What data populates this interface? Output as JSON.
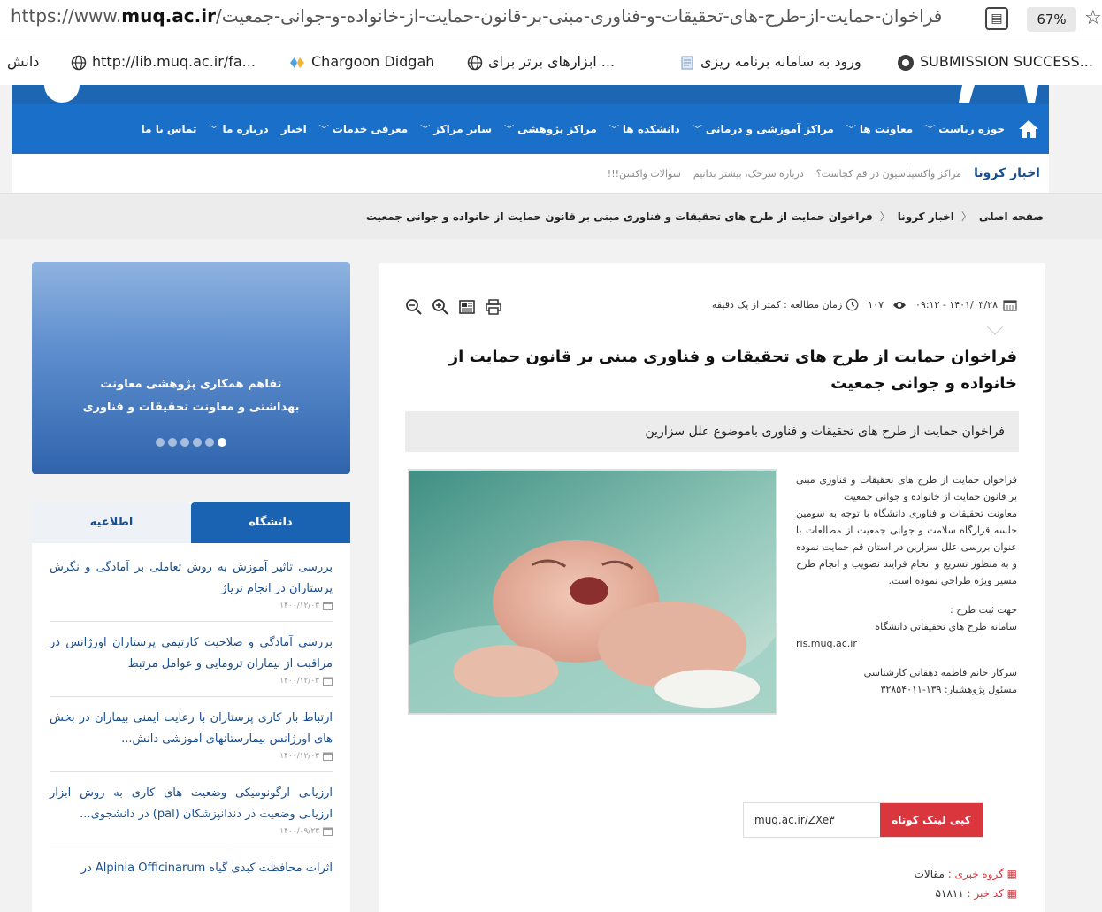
{
  "browser": {
    "url_host": "muq.ac.ir",
    "url_prefix": "https://www.",
    "url_path": "/فراخوان-حمایت-از-طرح-های-تحقیقات-و-فناوری-مبنی-بر-قانون-حمایت-از-خانواده-و-جوانی-جمعیت",
    "reader_icon": "reader-view-icon",
    "zoom": "67%",
    "bookmarks": [
      {
        "label": "http://lib.muq.ac.ir/fa...",
        "icon": "globe-icon"
      },
      {
        "label": "Chargoon Didgah",
        "icon": "chargoon-icon"
      },
      {
        "label": "ابزارهای برتر برای ...",
        "icon": "globe-icon"
      },
      {
        "label": "ورود به سامانه برنامه ریزی",
        "icon": "page-icon"
      },
      {
        "label": "SUBMISSION SUCCESS...",
        "icon": "submission-icon"
      },
      {
        "label": "دانش",
        "icon": ""
      }
    ]
  },
  "nav": {
    "items": [
      "حوزه ریاست",
      "معاونت ها",
      "مراکز آموزشی و درمانی",
      "دانشکده ها",
      "مراکز پژوهشی",
      "سایر مراکز",
      "معرفی خدمات",
      "اخبار",
      "درباره ما",
      "تماس با ما"
    ],
    "has_chevron": [
      true,
      true,
      true,
      true,
      true,
      true,
      true,
      false,
      true,
      false
    ]
  },
  "news_strip": {
    "label": "اخبار کرونا",
    "items": [
      "مراکز واکسیناسیون در قم کجاست؟",
      "درباره سرخک، بیشتر بدانیم",
      "سوالات واکسن!!!"
    ]
  },
  "breadcrumb": [
    "صفحه اصلی",
    "اخبار کرونا",
    "فراخوان حمایت از طرح های تحقیقات و فناوری مبنی بر قانون حمایت از خانواده و جوانی جمعیت"
  ],
  "article": {
    "date": "۱۴۰۱/۰۳/۲۸ - ۰۹:۱۳",
    "views": "۱۰۷",
    "reading_time": "زمان مطالعه : کمتر از یک دقیقه",
    "title": "فراخوان حمایت از طرح های تحقیقات و فناوری مبنی بر قانون حمایت از خانواده و جوانی جمعیت",
    "lead": "فراخوان حمایت از طرح های تحقیقات و فناوری باموضوع علل سزارین",
    "body_1": "فراخوان حمایت از طرح های تحقیقات و فناوری مبنی بر قانون حمایت از خانواده و جوانی جمعیت",
    "body_2": "معاونت تحقیقات و فناوری دانشگاه با توجه به سومین جلسه قرارگاه سلامت و جوانی جمعیت از مطالعات با عنوان بررسی علل سزارین در استان قم حمایت نموده و به منظور تسریع و انجام فرایند تصویب و انجام طرح مسیر ویژه طراحی نموده است.",
    "submit_label": "جهت ثبت طرح :",
    "submit_system": "سامانه طرح های تحقیقاتی دانشگاه",
    "submit_url": "ris.muq.ac.ir",
    "contact_1": "سرکار خانم فاطمه دهقانی کارشناسی",
    "contact_2": "مسئول پژوهشیار: ۱۳۹-۳۲۸۵۴۰۱۱",
    "copy_button": "کپی لینک کوتاه",
    "short_link": "muq.ac.ir/ZXe۳",
    "news_group_label": "گروه خبری :",
    "news_group_value": "مقالات",
    "news_code_label": "کد خبر :",
    "news_code_value": "۵۱۸۱۱"
  },
  "sidebar": {
    "promo_text_1": "تفاهم همکاری پژوهشی معاونت",
    "promo_text_2": "بهداشتی و معاونت تحقیقات و فناوری",
    "dots_total": 6,
    "dots_active": 6,
    "tab_active": "دانشگاه",
    "tab_inactive": "اطلاعیه",
    "list": [
      {
        "title": "بررسی تاثیر آموزش به روش تعاملی بر آمادگی و نگرش پرستاران در انجام تریاژ",
        "date": "۱۴۰۰/۱۲/۰۳"
      },
      {
        "title": "بررسی آمادگی و صلاحیت کارتیمی پرستاران اورژانس در مراقبت از بیماران ترومایی و عوامل مرتبط",
        "date": "۱۴۰۰/۱۲/۰۳"
      },
      {
        "title": "ارتباط بار کاری پرستاران با رعایت ایمنی بیماران در بخش های اورژانس بیمارستانهای آموزشی دانش...",
        "date": "۱۴۰۰/۱۲/۰۳"
      },
      {
        "title": "ارزیابی ارگونومیکی وضعیت های کاری به روش ابزار ارزیابی وضعیت در دندانپزشکان (pal) در دانشجوی...",
        "date": "۱۴۰۰/۰۹/۲۳"
      },
      {
        "title": "اثرات محافظت کبدی گیاه Alpinia Officinarum در",
        "date": ""
      }
    ]
  },
  "colors": {
    "primary": "#1a6fc9",
    "accent_red": "#d9363e",
    "link_blue": "#1a4f8c"
  }
}
